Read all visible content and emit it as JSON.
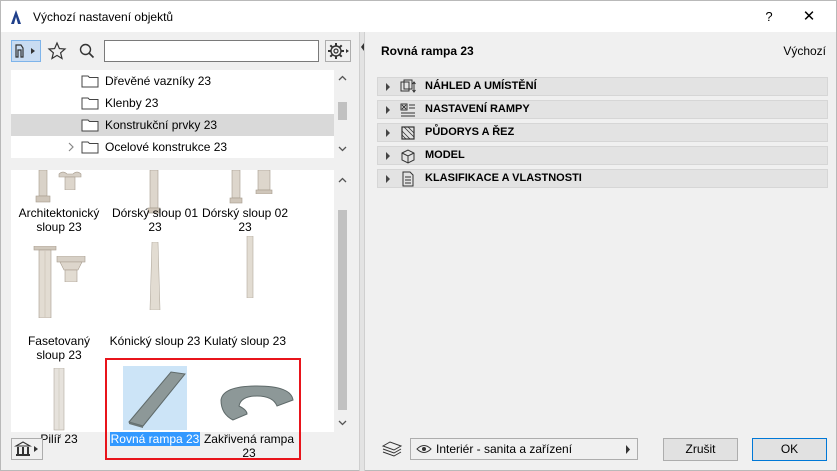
{
  "window": {
    "title": "Výchozí nastavení objektů",
    "help_label": "?",
    "close_label": "✕"
  },
  "toolbar": {
    "search_placeholder": "",
    "search_value": ""
  },
  "tree": {
    "items": [
      {
        "label": "Dřevěné vazníky 23",
        "selected": false,
        "expandable": false
      },
      {
        "label": "Klenby 23",
        "selected": false,
        "expandable": false
      },
      {
        "label": "Konstrukční prvky 23",
        "selected": true,
        "expandable": false
      },
      {
        "label": "Ocelové konstrukce 23",
        "selected": false,
        "expandable": true
      }
    ]
  },
  "objects": {
    "items": [
      {
        "label_line1": "Architektonický",
        "label_line2": "sloup 23"
      },
      {
        "label_line1": "Dórský sloup 01",
        "label_line2": "23"
      },
      {
        "label_line1": "Dórský sloup 02",
        "label_line2": "23"
      },
      {
        "label_line1": "Fasetovaný",
        "label_line2": "sloup 23"
      },
      {
        "label_line1": "Kónický sloup 23",
        "label_line2": ""
      },
      {
        "label_line1": "Kulatý sloup 23",
        "label_line2": ""
      },
      {
        "label_line1": "Pilíř 23",
        "label_line2": ""
      },
      {
        "label_line1": "Rovná rampa 23",
        "label_line2": "",
        "selected": true
      },
      {
        "label_line1": "Zakřivená rampa",
        "label_line2": "23"
      }
    ]
  },
  "details": {
    "object_name": "Rovná rampa 23",
    "default_label": "Výchozí",
    "panels": [
      {
        "label": "NÁHLED A UMÍSTĚNÍ",
        "icon": "preview-placement-icon"
      },
      {
        "label": "NASTAVENÍ RAMPY",
        "icon": "ramp-settings-icon"
      },
      {
        "label": "PŮDORYS A ŘEZ",
        "icon": "floorplan-section-icon"
      },
      {
        "label": "MODEL",
        "icon": "model-cube-icon"
      },
      {
        "label": "KLASIFIKACE A VLASTNOSTI",
        "icon": "classification-icon"
      }
    ]
  },
  "footer": {
    "layer_label": "Interiér - sanita a zařízení",
    "cancel_label": "Zrušit",
    "ok_label": "OK"
  },
  "colors": {
    "selection_blue": "#3399ff",
    "highlight_red": "#e8141b"
  }
}
